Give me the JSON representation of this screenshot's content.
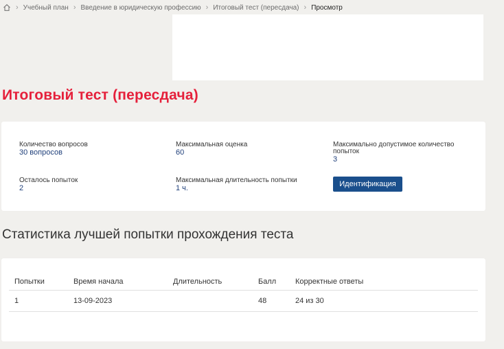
{
  "breadcrumb": {
    "items": [
      {
        "label": "Учебный план"
      },
      {
        "label": "Введение в юридическую профессию"
      },
      {
        "label": "Итоговый тест (пересдача)"
      },
      {
        "label": "Просмотр"
      }
    ]
  },
  "page_title": "Итоговый тест (пересдача)",
  "info": {
    "questions_count": {
      "label": "Количество вопросов",
      "value": "30 вопросов"
    },
    "max_score": {
      "label": "Максимальная оценка",
      "value": "60"
    },
    "max_attempts": {
      "label": "Максимально допустимое количество попыток",
      "value": "3"
    },
    "attempts_left": {
      "label": "Осталось попыток",
      "value": "2"
    },
    "max_duration": {
      "label": "Максимальная длительность попытки",
      "value": "1 ч."
    },
    "identify_button": "Идентификация"
  },
  "stats": {
    "heading": "Статистика лучшей попытки прохождения теста",
    "columns": [
      "Попытки",
      "Время начала",
      "Длительность",
      "Балл",
      "Корректные ответы"
    ],
    "rows": [
      [
        "1",
        "13-09-2023",
        "",
        "48",
        "24 из 30"
      ]
    ]
  },
  "colors": {
    "title_red": "#e5203b",
    "value_blue": "#1f3f7a",
    "button_blue": "#1a4f8c",
    "background": "#f1f0ed"
  },
  "icons": {
    "home": "home-icon",
    "separator": "chevron-right-icon"
  }
}
